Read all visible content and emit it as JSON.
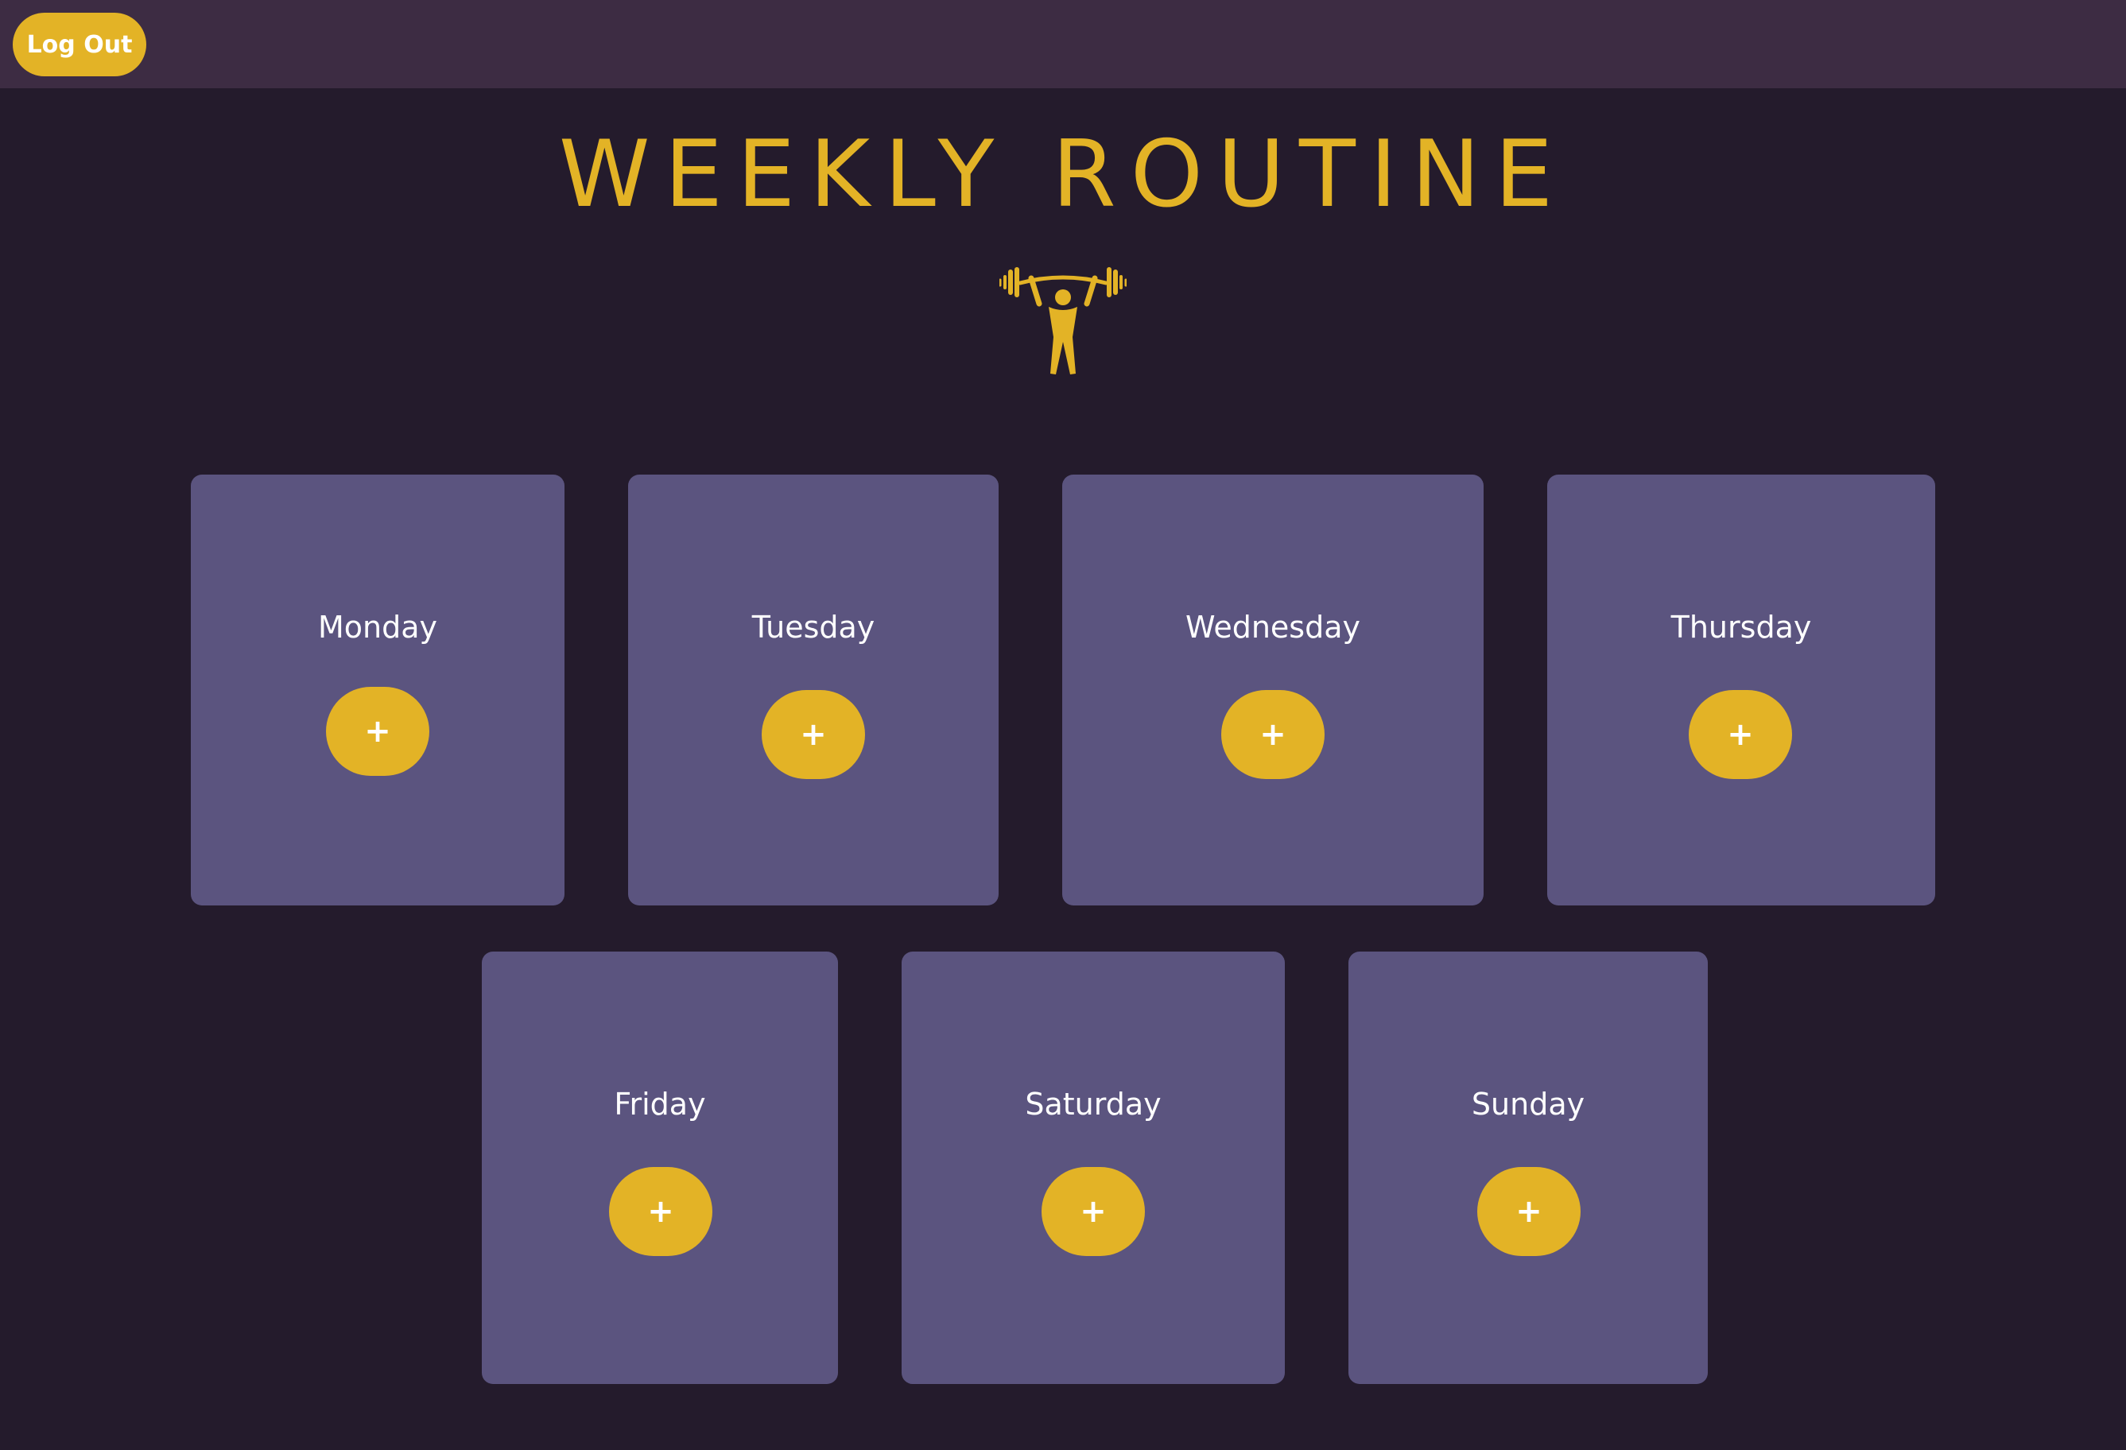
{
  "header": {
    "logout_label": "Log Out"
  },
  "page": {
    "title": "WEEKLY ROUTINE",
    "logo_icon": "weightlifter-icon"
  },
  "days": [
    {
      "label": "Monday",
      "add_label": "+"
    },
    {
      "label": "Tuesday",
      "add_label": "+"
    },
    {
      "label": "Wednesday",
      "add_label": "+"
    },
    {
      "label": "Thursday",
      "add_label": "+"
    },
    {
      "label": "Friday",
      "add_label": "+"
    },
    {
      "label": "Saturday",
      "add_label": "+"
    },
    {
      "label": "Sunday",
      "add_label": "+"
    }
  ],
  "colors": {
    "background": "#241b2c",
    "topbar": "#3d2c43",
    "accent": "#e3b326",
    "card": "#5b547f",
    "text": "#ffffff"
  }
}
